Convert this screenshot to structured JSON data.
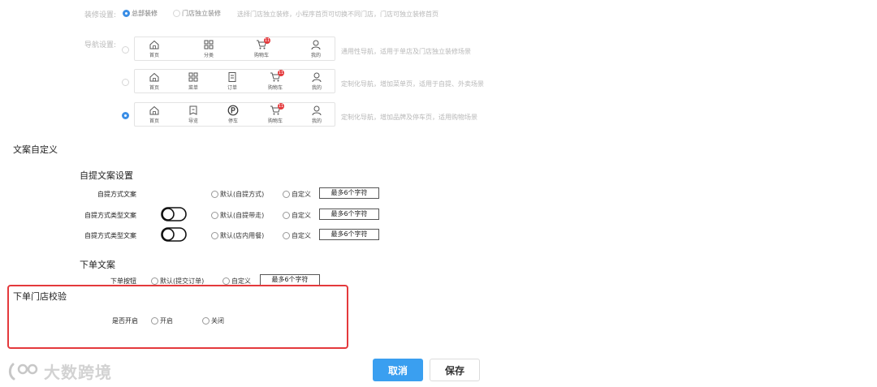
{
  "decor": {
    "label": "装修设置:",
    "options": [
      {
        "label": "总部装修",
        "selected": true
      },
      {
        "label": "门店独立装修",
        "selected": false
      }
    ],
    "hint": "选择门店独立装修，小程序首页可切换不同门店，门店可独立装修首页"
  },
  "nav": {
    "label": "导航设置:",
    "badge": "11",
    "rows": [
      {
        "selected": false,
        "items": [
          {
            "label": "首页",
            "icon": "home-icon"
          },
          {
            "label": "分类",
            "icon": "grid-icon"
          },
          {
            "label": "购物车",
            "icon": "cart-icon"
          },
          {
            "label": "我的",
            "icon": "user-icon"
          }
        ],
        "desc": "通用性导航，适用于单店及门店独立装修场景"
      },
      {
        "selected": false,
        "items": [
          {
            "label": "首页",
            "icon": "home-icon"
          },
          {
            "label": "菜单",
            "icon": "grid-icon"
          },
          {
            "label": "订单",
            "icon": "document-icon"
          },
          {
            "label": "购物车",
            "icon": "cart-icon"
          },
          {
            "label": "我的",
            "icon": "user-icon"
          }
        ],
        "desc": "定制化导航，增加菜单页，适用于自提、外卖场景"
      },
      {
        "selected": true,
        "items": [
          {
            "label": "首页",
            "icon": "home-icon"
          },
          {
            "label": "导览",
            "icon": "guide-icon"
          },
          {
            "label": "停车",
            "icon": "parking-icon"
          },
          {
            "label": "购物车",
            "icon": "cart-icon"
          },
          {
            "label": "我的",
            "icon": "user-icon"
          }
        ],
        "desc": "定制化导航，增加品牌及停车页，适用购物场景"
      }
    ]
  },
  "copy_section": {
    "title": "文案自定义"
  },
  "pickup": {
    "title": "自提文案设置",
    "rows": [
      {
        "label": "自提方式文案",
        "default": "默认(自提方式)",
        "custom": "自定义",
        "box": "最多6个字符"
      },
      {
        "label": "自提方式类型文案",
        "default": "默认(自提带走)",
        "custom": "自定义",
        "box": "最多6个字符"
      },
      {
        "label": "自提方式类型文案",
        "default": "默认(店内用餐)",
        "custom": "自定义",
        "box": "最多6个字符"
      }
    ]
  },
  "order_copy": {
    "title": "下单文案",
    "label": "下单按钮",
    "default": "默认(提交订单)",
    "custom": "自定义",
    "box": "最多6个字符"
  },
  "store_check": {
    "title": "下单门店校验",
    "label": "是否开启",
    "on": "开启",
    "off": "关闭",
    "highlight_color": "#e4393c"
  },
  "footer": {
    "cancel": "取消",
    "save": "保存",
    "watermark": "大数跨境",
    "accent": "#3a9ff0"
  }
}
